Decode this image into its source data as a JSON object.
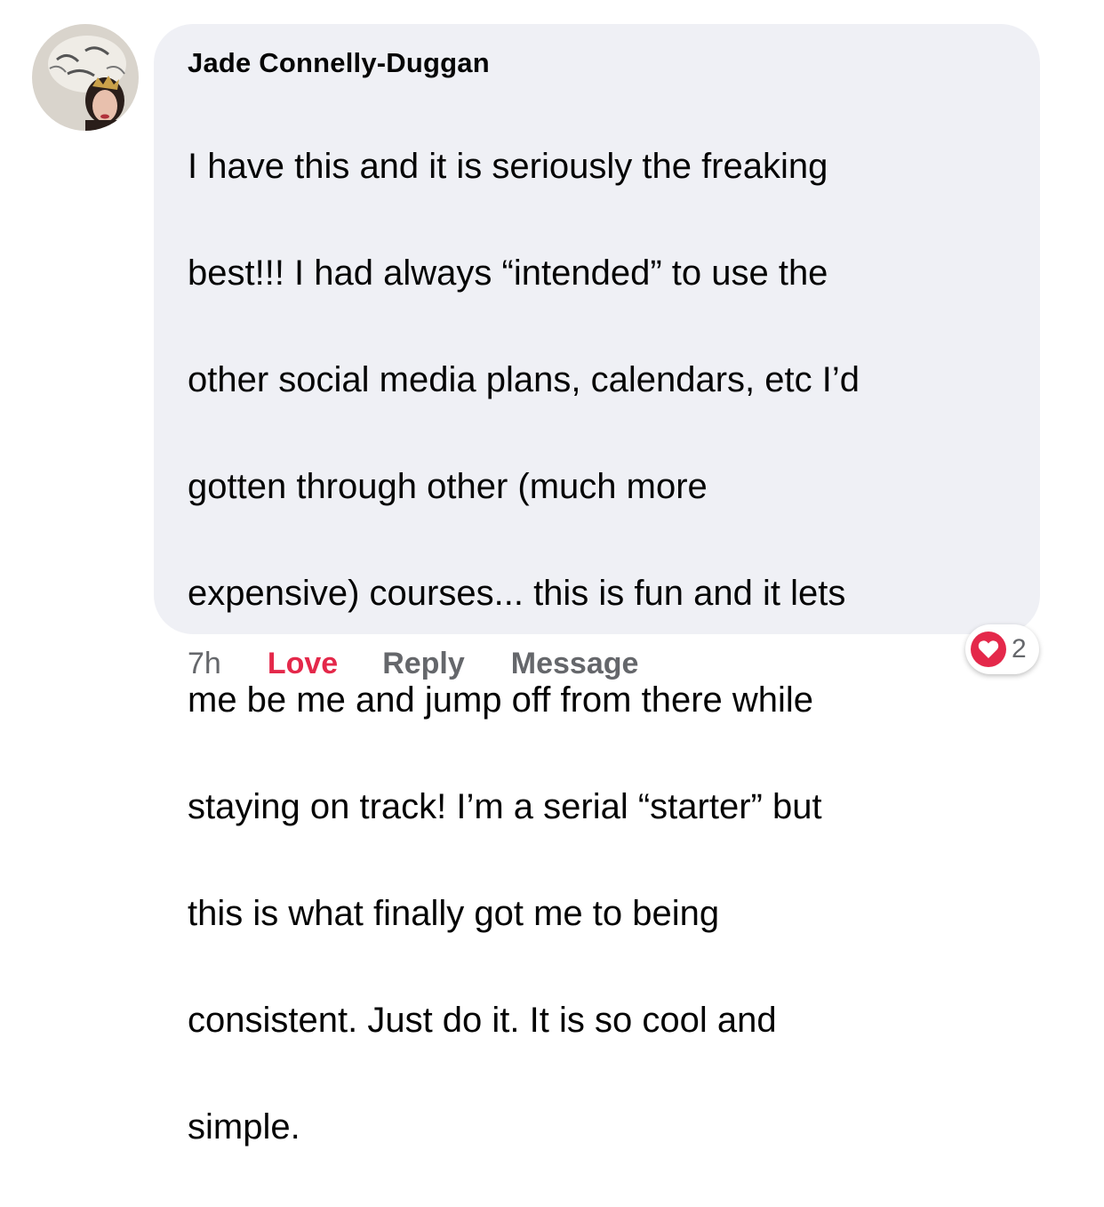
{
  "comment": {
    "author": "Jade Connelly-Duggan",
    "text_lines": [
      "I have this and it is seriously the freaking",
      "best!!! I had always “intended” to use the",
      "other social media plans, calendars, etc I’d",
      "gotten through other (much more",
      "expensive) courses... this is fun and it lets",
      "me be me and jump off from there while",
      "staying on track! I’m a serial “starter” but",
      "this is what finally got me to being",
      "consistent.  Just do it. It is so cool and",
      "simple."
    ]
  },
  "actions": {
    "time": "7h",
    "love_label": "Love",
    "reply_label": "Reply",
    "message_label": "Message"
  },
  "reaction": {
    "icon": "heart-icon",
    "count": "2"
  },
  "colors": {
    "bubble_bg": "#eff0f5",
    "love_red": "#e4284a",
    "meta_gray": "#65676b"
  }
}
